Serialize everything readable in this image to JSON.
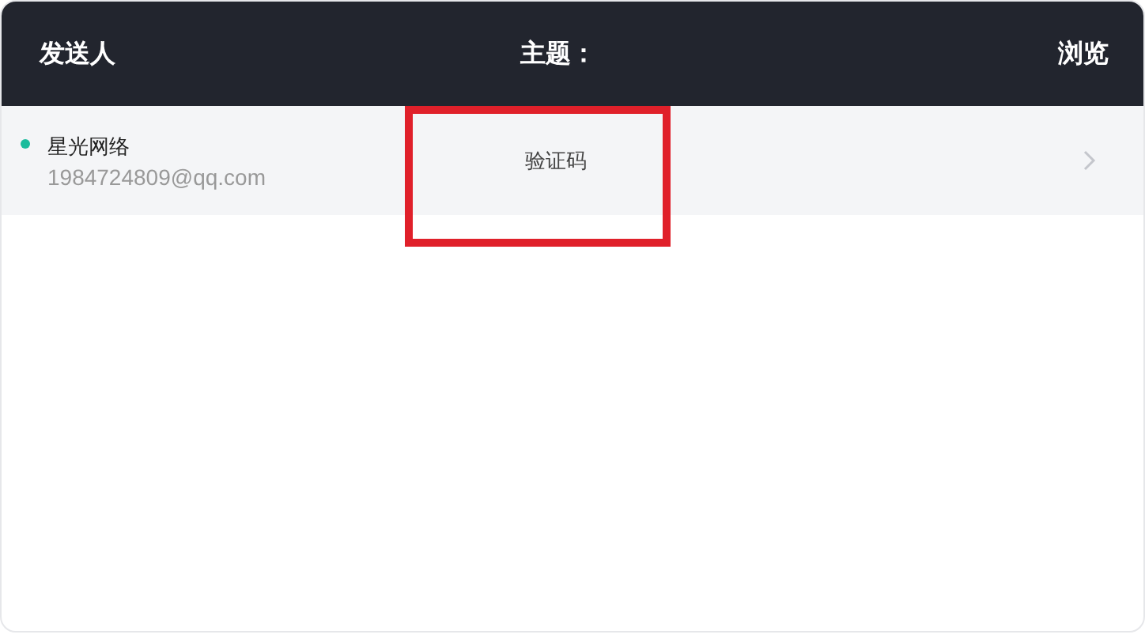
{
  "table": {
    "columns": [
      "发送人",
      "主题：",
      "浏览"
    ],
    "rows": [
      {
        "unread": true,
        "sender": "星光网络",
        "email": "1984724809@qq.com",
        "subject": "验证码",
        "subject_highlighted": true
      }
    ]
  }
}
